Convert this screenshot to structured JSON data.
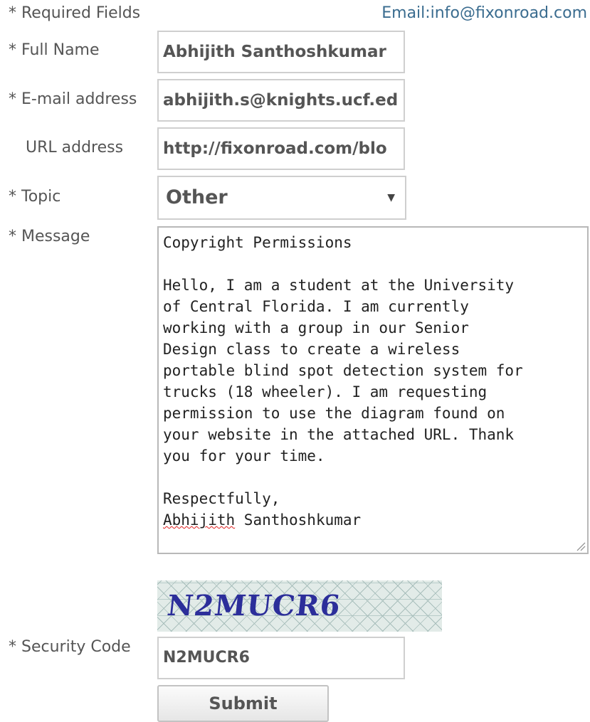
{
  "header": {
    "required_note": "* Required Fields",
    "email_contact": "Email:info@fixonroad.com"
  },
  "form": {
    "full_name": {
      "label": "* Full Name",
      "value": "Abhijith Santhoshkumar"
    },
    "email": {
      "label": "* E-mail address",
      "value": "abhijith.s@knights.ucf.ed"
    },
    "url": {
      "label": "URL address",
      "value": "http://fixonroad.com/blo"
    },
    "topic": {
      "label": "* Topic",
      "selected": "Other"
    },
    "message": {
      "label": "* Message",
      "value_before_name": "Copyright Permissions\n\nHello, I am a student at the University\nof Central Florida. I am currently\nworking with a group in our Senior\nDesign class to create a wireless\nportable blind spot detection system for\ntrucks (18 wheeler). I am requesting\npermission to use the diagram found on\nyour website in the attached URL. Thank\nyou for your time.\n\nRespectfully,\n",
      "signature_first": "Abhijith",
      "signature_rest": " Santhoshkumar"
    },
    "captcha": {
      "text": "N2MUCR6"
    },
    "security_code": {
      "label": "* Security Code",
      "value": "N2MUCR6"
    },
    "submit_label": "Submit"
  }
}
